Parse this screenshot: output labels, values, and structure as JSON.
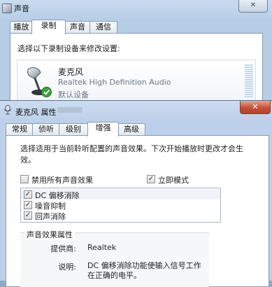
{
  "back_window": {
    "title": "声音",
    "close": "✕",
    "tabs": [
      "播放",
      "录制",
      "声音",
      "通信"
    ],
    "active_tab_index": 1,
    "instruction": "选择以下录制设备来修改设置:",
    "device": {
      "name": "麦克风",
      "description": "Realtek High Definition Audio",
      "status": "默认设备",
      "icon": "microphone-icon",
      "badge_icon": "default-check-icon",
      "level": 0
    }
  },
  "front_window": {
    "title": "麦克风 属性",
    "close": "✕",
    "tabs": [
      "常规",
      "侦听",
      "级别",
      "增强",
      "高级"
    ],
    "active_tab_index": 3,
    "description": "选择适用于当前聆听配置的声音效果。下次开始播放时更改才会生效。",
    "disable_all": {
      "label": "禁用所有声音效果",
      "checked": false
    },
    "immediate_mode": {
      "label": "立即模式",
      "checked": true
    },
    "effects": [
      {
        "label": "DC 偏移消除",
        "checked": true
      },
      {
        "label": "噪音抑制",
        "checked": true
      },
      {
        "label": "回声消除",
        "checked": true
      }
    ],
    "properties": {
      "group_title": "声音效果属性",
      "provider_label": "提供商:",
      "provider_value": "Realtek",
      "description_label": "说明:",
      "description_value": "DC 偏移消除功能使输入信号工作在正确的电平。"
    }
  },
  "colors": {
    "checkmark": "#2b3a4c",
    "badge_green": "#3aa23a",
    "close_red": "#c5503a"
  }
}
